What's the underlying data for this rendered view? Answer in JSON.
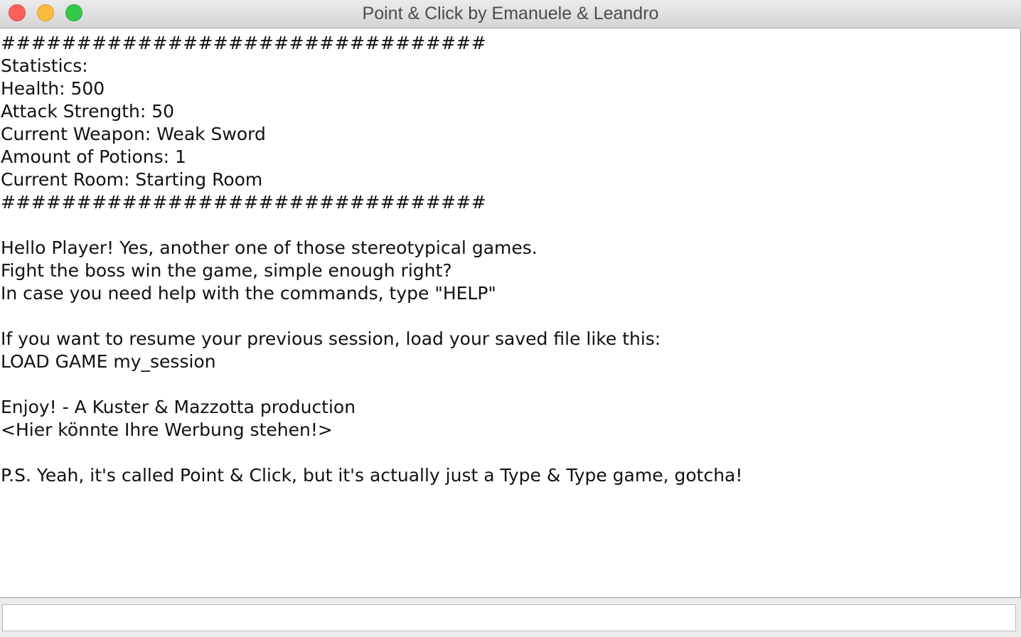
{
  "window": {
    "title": "Point & Click by Emanuele & Leandro"
  },
  "console": {
    "lines": [
      "################################",
      "Statistics:",
      "Health: 500",
      "Attack Strength: 50",
      "Current Weapon: Weak Sword",
      "Amount of Potions: 1",
      "Current Room: Starting Room",
      "################################",
      "",
      "Hello Player! Yes, another one of those stereotypical games.",
      "Fight the boss win the game, simple enough right?",
      "In case you need help with the commands, type \"HELP\"",
      "",
      "If you want to resume your previous session, load your saved file like this:",
      "LOAD GAME my_session",
      "",
      "Enjoy! - A Kuster & Mazzotta production",
      "<Hier könnte Ihre Werbung stehen!>",
      "",
      "P.S. Yeah, it's called Point & Click, but it's actually just a Type & Type game, gotcha!"
    ]
  },
  "command_input": {
    "value": "",
    "placeholder": ""
  },
  "colors": {
    "close": "#fc605b",
    "minimize": "#fdbc40",
    "zoom": "#34c84a"
  }
}
